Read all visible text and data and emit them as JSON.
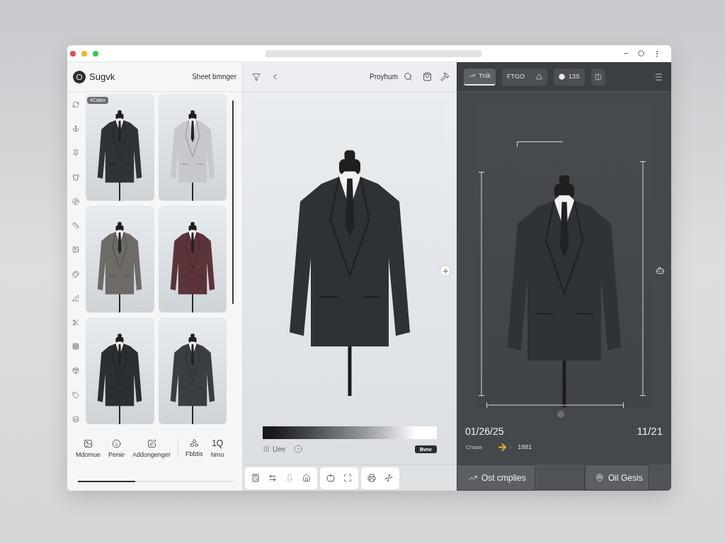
{
  "library": {
    "brand": "Sugvk",
    "action": "Sheet bmnger",
    "badge": "4Cnlex",
    "toolbar_groups": [
      [
        {
          "label": "Mdomue"
        },
        {
          "label": "Penie"
        },
        {
          "label": "Addongenger"
        }
      ],
      [
        {
          "label": "Fbbtis"
        },
        {
          "label": "Nmo",
          "glyph": "1Q"
        }
      ]
    ],
    "progress": {
      "level": 0.37
    }
  },
  "viewer": {
    "title": "Proyhum",
    "gradient_label": "Uee",
    "button": "Bvne"
  },
  "inspector": {
    "tabs": [
      {
        "label": "Tnik",
        "selected": true
      },
      {
        "label": "FTGO",
        "selected": false
      },
      {
        "label": "13S",
        "selected": false
      }
    ],
    "date": "01/26/25",
    "count": "11/21",
    "status_label": "Chase",
    "status_value": "1881",
    "actions": [
      "Ost cmplies",
      "Oil Gesis"
    ]
  }
}
